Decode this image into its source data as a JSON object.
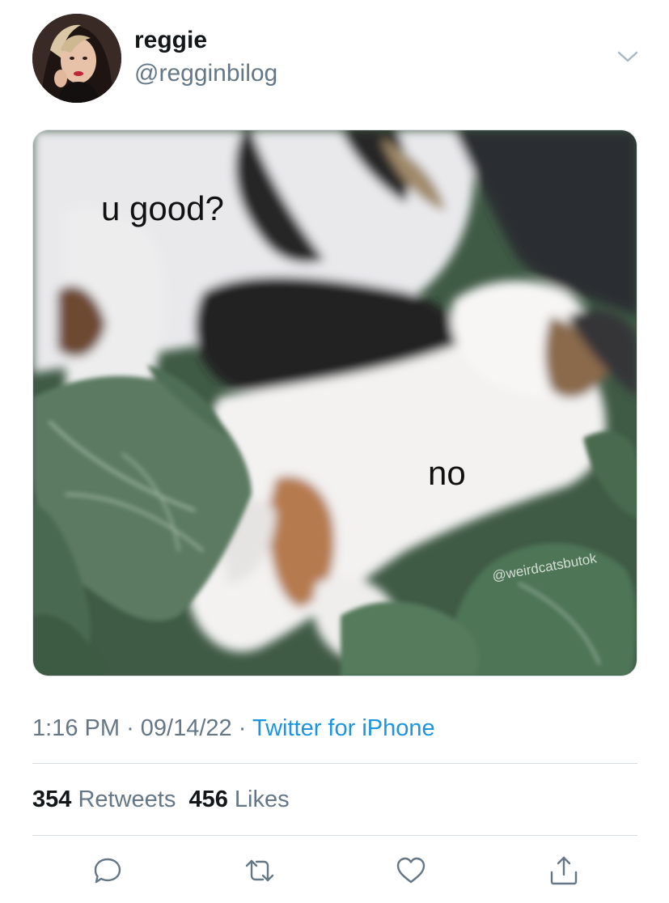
{
  "tweet": {
    "display_name": "reggie",
    "handle": "@regginbilog",
    "image": {
      "caption_top": "u good?",
      "caption_bottom": "no",
      "watermark": "@weirdcatsbutok"
    },
    "time": "1:16 PM",
    "date": "09/14/22",
    "separator": "·",
    "source": "Twitter for iPhone",
    "retweets_count": "354",
    "retweets_label": "Retweets",
    "likes_count": "456",
    "likes_label": "Likes"
  },
  "icons": {
    "more": "chevron-down-icon",
    "reply": "reply-icon",
    "retweet": "retweet-icon",
    "like": "heart-icon",
    "share": "share-icon"
  },
  "colors": {
    "text_primary": "#14171a",
    "text_secondary": "#657786",
    "link": "#1b95e0",
    "divider": "#d6dbdf"
  }
}
